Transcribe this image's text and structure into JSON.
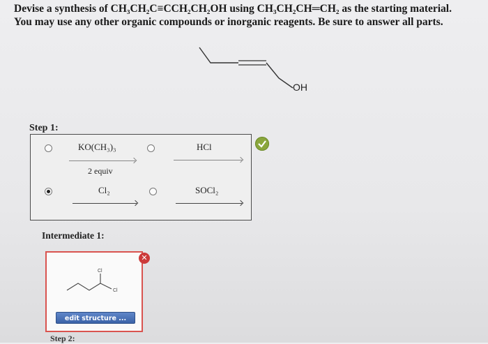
{
  "problem": {
    "line1": "Devise a synthesis of CH₃CH₂C≡CCH₂CH₂OH using CH₃CH₂CH═CH₂ as the starting material.",
    "line2": "You may use any other organic compounds or inorganic reagents. Be sure to answer all parts."
  },
  "target_molecule": {
    "oh_label": "OH"
  },
  "step1": {
    "label": "Step 1:",
    "options": [
      {
        "reagent": "KO(CH₃)₃",
        "sub": "2 equiv",
        "selected": false
      },
      {
        "reagent": "HCl",
        "selected": false
      },
      {
        "reagent": "Cl₂",
        "selected": true
      },
      {
        "reagent": "SOCl₂",
        "selected": false
      }
    ],
    "status_icon": "check-icon",
    "status_color": "#8aa63c"
  },
  "intermediate1": {
    "label": "Intermediate 1:",
    "atom_label_top": "Cl",
    "atom_label_right": "Cl",
    "edit_button": "edit structure ...",
    "status_icon": "x-icon",
    "status_color": "#cc3a3a",
    "x_glyph": "✕"
  },
  "step2": {
    "label": "Step 2:"
  }
}
